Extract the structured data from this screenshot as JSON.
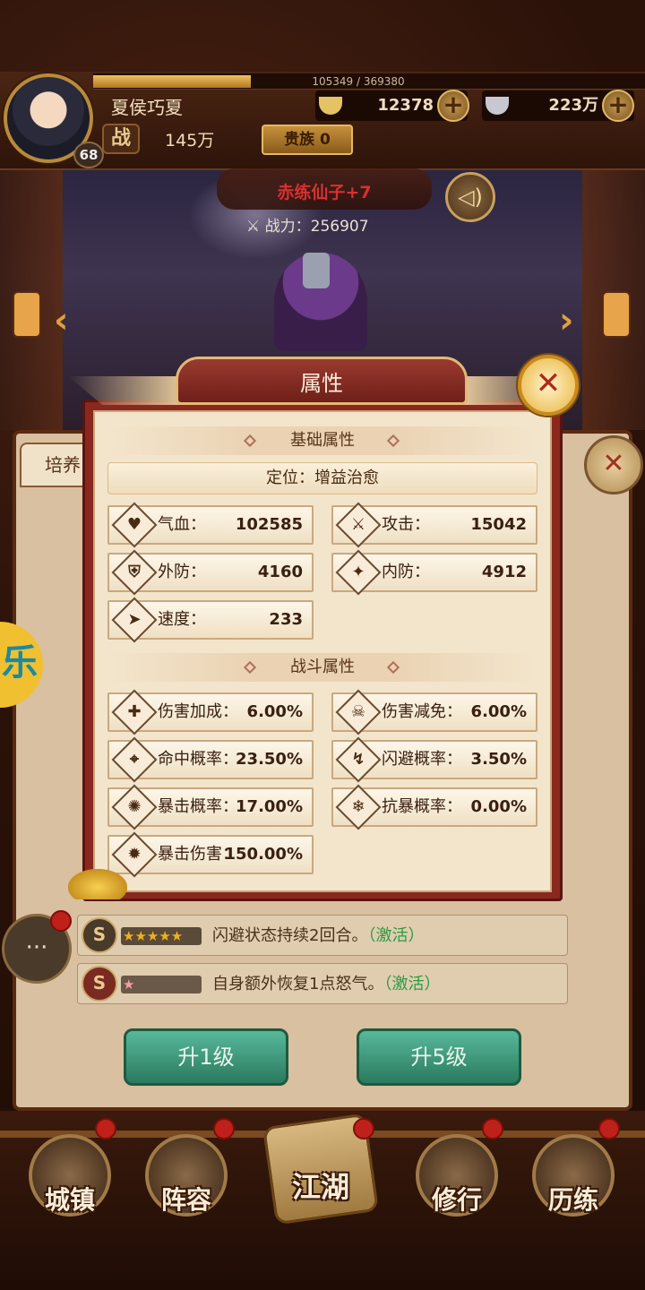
{
  "player": {
    "name": "夏侯巧夏",
    "level": "68",
    "exp_text": "105349 / 369380",
    "exp_fraction": 0.285,
    "battle_icon": "战",
    "battle_power": "145万",
    "noble": "贵族 0"
  },
  "currency": {
    "gold": "12378",
    "silver": "223万",
    "plus": "+"
  },
  "hero": {
    "name": "赤练仙子+7",
    "power_label": "战力：",
    "power": "256907"
  },
  "underlying": {
    "tab_label": "培养",
    "side_badge": "乐",
    "skills": [
      {
        "stars": "★★★★★",
        "text": "闪避状态持续2回合。",
        "activate": "（激活）"
      },
      {
        "stars": "★",
        "text": "自身额外恢复1点怒气。",
        "activate": "（激活）"
      }
    ],
    "skill_icon": "S",
    "buttons": {
      "up1": "升1级",
      "up5": "升5级"
    },
    "chat_icon": "···"
  },
  "modal": {
    "title": "属性",
    "close_icon": "✕",
    "basic_section": "基础属性",
    "role_label": "定位：",
    "role_value": "增益治愈",
    "basic_stats": [
      {
        "label": "气血：",
        "value": "102585",
        "glyph": "♥"
      },
      {
        "label": "攻击：",
        "value": "15042",
        "glyph": "⚔"
      },
      {
        "label": "外防：",
        "value": "4160",
        "glyph": "⛨"
      },
      {
        "label": "内防：",
        "value": "4912",
        "glyph": "✦"
      },
      {
        "label": "速度：",
        "value": "233",
        "glyph": "➤"
      }
    ],
    "combat_section": "战斗属性",
    "combat_stats": [
      {
        "label": "伤害加成：",
        "value": "6.00%",
        "glyph": "✚"
      },
      {
        "label": "伤害减免：",
        "value": "6.00%",
        "glyph": "☠"
      },
      {
        "label": "命中概率：",
        "value": "23.50%",
        "glyph": "⌖"
      },
      {
        "label": "闪避概率：",
        "value": "3.50%",
        "glyph": "↯"
      },
      {
        "label": "暴击概率：",
        "value": "17.00%",
        "glyph": "✺"
      },
      {
        "label": "抗暴概率：",
        "value": "0.00%",
        "glyph": "❄"
      },
      {
        "label": "暴击伤害：",
        "value": "150.00%",
        "glyph": "✹"
      }
    ]
  },
  "nav": [
    {
      "label": "城镇"
    },
    {
      "label": "阵容"
    },
    {
      "label": "江湖"
    },
    {
      "label": "修行"
    },
    {
      "label": "历练"
    }
  ],
  "colors": {
    "modal_frame": "#8a2820",
    "modal_bg": "#f3e5cc",
    "hero_name": "#d83030",
    "button_green": "#2a7a5e",
    "skill_active": "#2a9a40"
  }
}
